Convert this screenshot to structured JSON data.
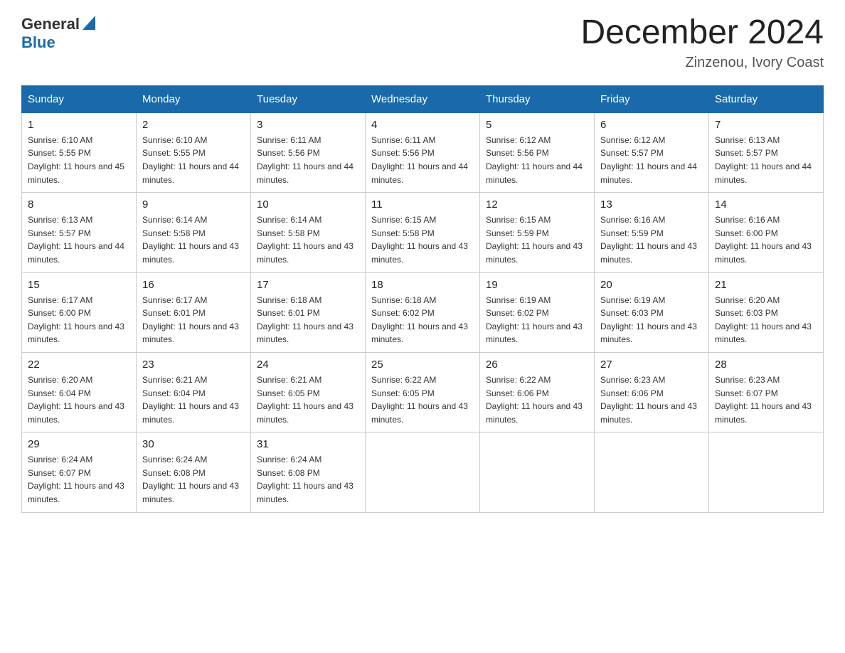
{
  "header": {
    "logo_general": "General",
    "logo_blue": "Blue",
    "month_title": "December 2024",
    "location": "Zinzenou, Ivory Coast"
  },
  "days_of_week": [
    "Sunday",
    "Monday",
    "Tuesday",
    "Wednesday",
    "Thursday",
    "Friday",
    "Saturday"
  ],
  "weeks": [
    [
      {
        "day": "1",
        "sunrise": "6:10 AM",
        "sunset": "5:55 PM",
        "daylight": "11 hours and 45 minutes."
      },
      {
        "day": "2",
        "sunrise": "6:10 AM",
        "sunset": "5:55 PM",
        "daylight": "11 hours and 44 minutes."
      },
      {
        "day": "3",
        "sunrise": "6:11 AM",
        "sunset": "5:56 PM",
        "daylight": "11 hours and 44 minutes."
      },
      {
        "day": "4",
        "sunrise": "6:11 AM",
        "sunset": "5:56 PM",
        "daylight": "11 hours and 44 minutes."
      },
      {
        "day": "5",
        "sunrise": "6:12 AM",
        "sunset": "5:56 PM",
        "daylight": "11 hours and 44 minutes."
      },
      {
        "day": "6",
        "sunrise": "6:12 AM",
        "sunset": "5:57 PM",
        "daylight": "11 hours and 44 minutes."
      },
      {
        "day": "7",
        "sunrise": "6:13 AM",
        "sunset": "5:57 PM",
        "daylight": "11 hours and 44 minutes."
      }
    ],
    [
      {
        "day": "8",
        "sunrise": "6:13 AM",
        "sunset": "5:57 PM",
        "daylight": "11 hours and 44 minutes."
      },
      {
        "day": "9",
        "sunrise": "6:14 AM",
        "sunset": "5:58 PM",
        "daylight": "11 hours and 43 minutes."
      },
      {
        "day": "10",
        "sunrise": "6:14 AM",
        "sunset": "5:58 PM",
        "daylight": "11 hours and 43 minutes."
      },
      {
        "day": "11",
        "sunrise": "6:15 AM",
        "sunset": "5:58 PM",
        "daylight": "11 hours and 43 minutes."
      },
      {
        "day": "12",
        "sunrise": "6:15 AM",
        "sunset": "5:59 PM",
        "daylight": "11 hours and 43 minutes."
      },
      {
        "day": "13",
        "sunrise": "6:16 AM",
        "sunset": "5:59 PM",
        "daylight": "11 hours and 43 minutes."
      },
      {
        "day": "14",
        "sunrise": "6:16 AM",
        "sunset": "6:00 PM",
        "daylight": "11 hours and 43 minutes."
      }
    ],
    [
      {
        "day": "15",
        "sunrise": "6:17 AM",
        "sunset": "6:00 PM",
        "daylight": "11 hours and 43 minutes."
      },
      {
        "day": "16",
        "sunrise": "6:17 AM",
        "sunset": "6:01 PM",
        "daylight": "11 hours and 43 minutes."
      },
      {
        "day": "17",
        "sunrise": "6:18 AM",
        "sunset": "6:01 PM",
        "daylight": "11 hours and 43 minutes."
      },
      {
        "day": "18",
        "sunrise": "6:18 AM",
        "sunset": "6:02 PM",
        "daylight": "11 hours and 43 minutes."
      },
      {
        "day": "19",
        "sunrise": "6:19 AM",
        "sunset": "6:02 PM",
        "daylight": "11 hours and 43 minutes."
      },
      {
        "day": "20",
        "sunrise": "6:19 AM",
        "sunset": "6:03 PM",
        "daylight": "11 hours and 43 minutes."
      },
      {
        "day": "21",
        "sunrise": "6:20 AM",
        "sunset": "6:03 PM",
        "daylight": "11 hours and 43 minutes."
      }
    ],
    [
      {
        "day": "22",
        "sunrise": "6:20 AM",
        "sunset": "6:04 PM",
        "daylight": "11 hours and 43 minutes."
      },
      {
        "day": "23",
        "sunrise": "6:21 AM",
        "sunset": "6:04 PM",
        "daylight": "11 hours and 43 minutes."
      },
      {
        "day": "24",
        "sunrise": "6:21 AM",
        "sunset": "6:05 PM",
        "daylight": "11 hours and 43 minutes."
      },
      {
        "day": "25",
        "sunrise": "6:22 AM",
        "sunset": "6:05 PM",
        "daylight": "11 hours and 43 minutes."
      },
      {
        "day": "26",
        "sunrise": "6:22 AM",
        "sunset": "6:06 PM",
        "daylight": "11 hours and 43 minutes."
      },
      {
        "day": "27",
        "sunrise": "6:23 AM",
        "sunset": "6:06 PM",
        "daylight": "11 hours and 43 minutes."
      },
      {
        "day": "28",
        "sunrise": "6:23 AM",
        "sunset": "6:07 PM",
        "daylight": "11 hours and 43 minutes."
      }
    ],
    [
      {
        "day": "29",
        "sunrise": "6:24 AM",
        "sunset": "6:07 PM",
        "daylight": "11 hours and 43 minutes."
      },
      {
        "day": "30",
        "sunrise": "6:24 AM",
        "sunset": "6:08 PM",
        "daylight": "11 hours and 43 minutes."
      },
      {
        "day": "31",
        "sunrise": "6:24 AM",
        "sunset": "6:08 PM",
        "daylight": "11 hours and 43 minutes."
      },
      null,
      null,
      null,
      null
    ]
  ]
}
